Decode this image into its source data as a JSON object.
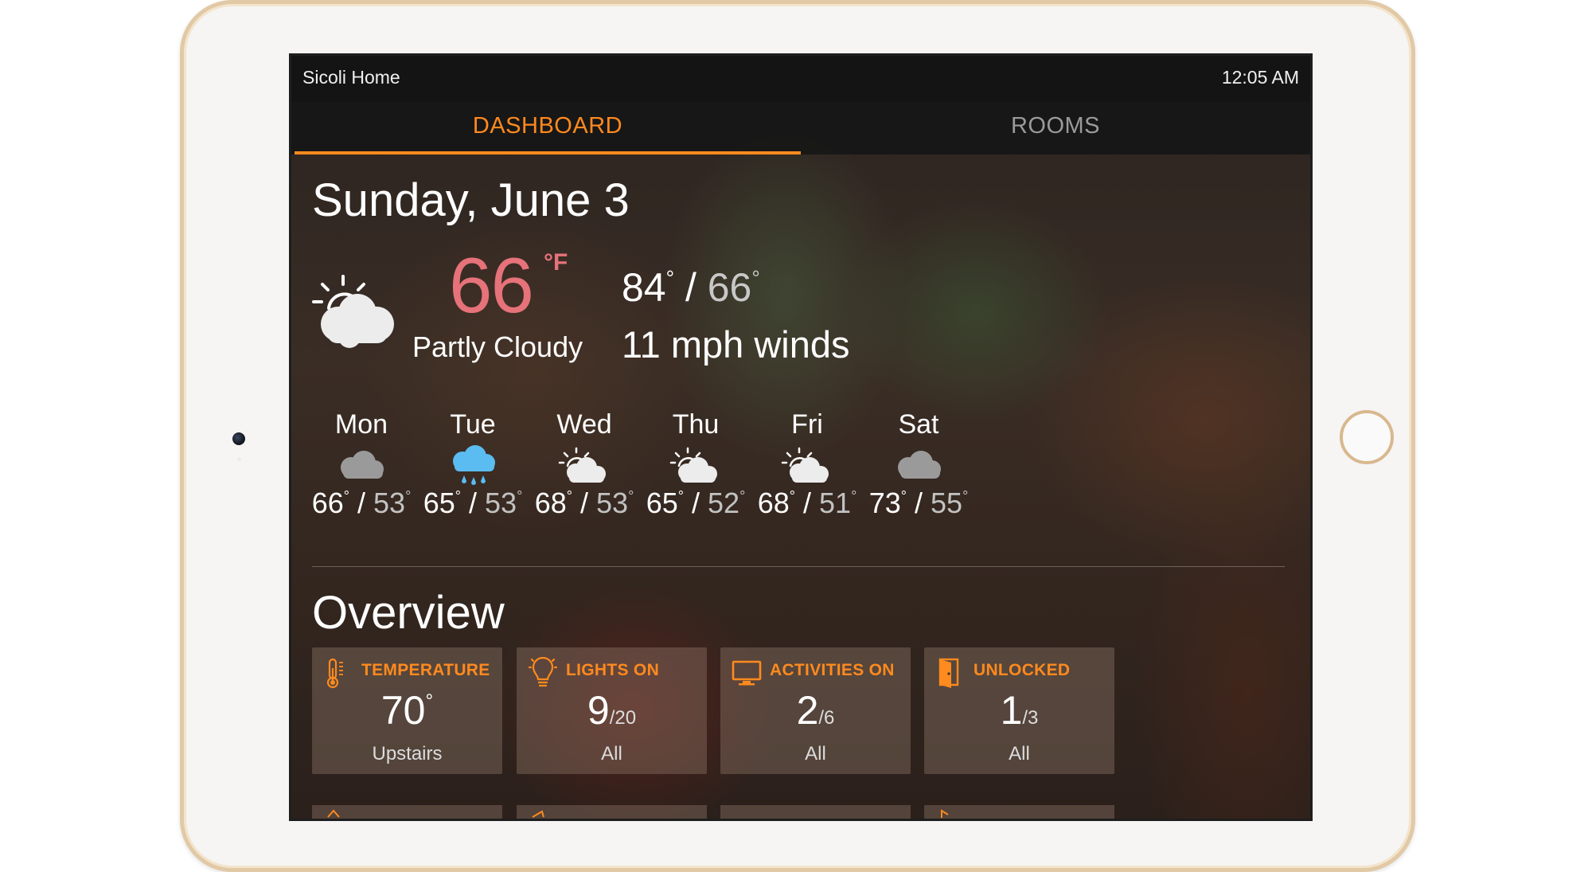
{
  "status": {
    "title": "Sicoli Home",
    "time": "12:05 AM"
  },
  "tabs": {
    "dashboard": "DASHBOARD",
    "rooms": "ROOMS"
  },
  "date": "Sunday, June 3",
  "current": {
    "temp": "66",
    "unit": "°F",
    "condition": "Partly Cloudy",
    "high": "84",
    "low": "66",
    "winds": "11 mph winds",
    "icon": "partly-cloudy-icon"
  },
  "deg": "°",
  "slash": "/",
  "forecast": [
    {
      "day": "Mon",
      "icon": "cloudy-icon",
      "high": "66",
      "low": "53"
    },
    {
      "day": "Tue",
      "icon": "rain-icon",
      "high": "65",
      "low": "53"
    },
    {
      "day": "Wed",
      "icon": "partly-cloudy-icon",
      "high": "68",
      "low": "53"
    },
    {
      "day": "Thu",
      "icon": "partly-cloudy-icon",
      "high": "65",
      "low": "52"
    },
    {
      "day": "Fri",
      "icon": "partly-cloudy-icon",
      "high": "68",
      "low": "51"
    },
    {
      "day": "Sat",
      "icon": "cloudy-icon",
      "high": "73",
      "low": "55"
    }
  ],
  "overview": {
    "title": "Overview",
    "cards": [
      {
        "label": "TEMPERATURE",
        "icon": "thermometer-icon",
        "value": "70",
        "total": "",
        "caption": "Upstairs"
      },
      {
        "label": "LIGHTS ON",
        "icon": "lightbulb-icon",
        "value": "9",
        "total": "/20",
        "caption": "All"
      },
      {
        "label": "ACTIVITIES ON",
        "icon": "tv-icon",
        "value": "2",
        "total": "/6",
        "caption": "All"
      },
      {
        "label": "UNLOCKED",
        "icon": "door-icon",
        "value": "1",
        "total": "/3",
        "caption": "All"
      }
    ]
  },
  "colors": {
    "accent": "#ff8a1e",
    "current_temp": "#e6727a",
    "rain": "#5bbcf2"
  }
}
